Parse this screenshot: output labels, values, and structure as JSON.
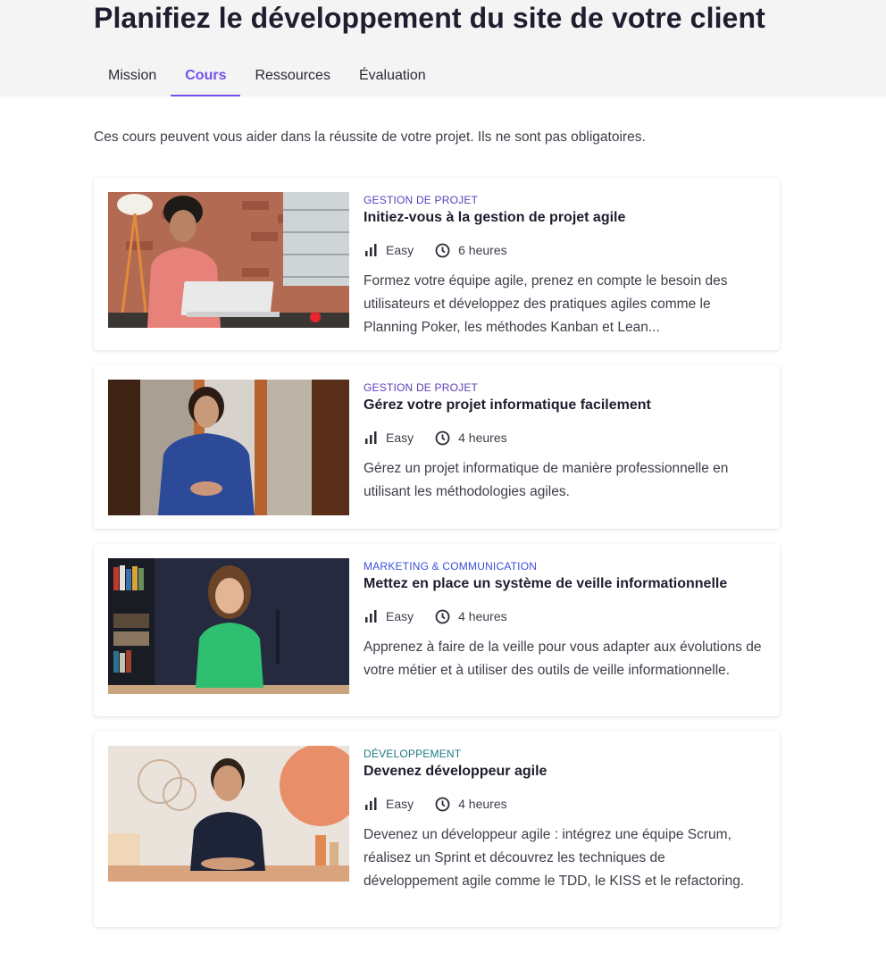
{
  "page": {
    "title": "Planifiez le développement du site de votre client",
    "tabs": [
      {
        "label": "Mission"
      },
      {
        "label": "Cours"
      },
      {
        "label": "Ressources"
      },
      {
        "label": "Évaluation"
      }
    ],
    "active_tab": "Cours",
    "intro": "Ces cours peuvent vous aider dans la réussite de votre projet. Ils ne sont pas obligatoires."
  },
  "colors": {
    "accent": "#7451eb",
    "category_project": "#5b3fb8",
    "category_marketing": "#3b4fd6",
    "category_dev": "#1e7a86"
  },
  "courses": [
    {
      "category": "Gestion de projet",
      "title": "Initiez-vous à la gestion de projet agile",
      "difficulty": "Easy",
      "duration": "6 heures",
      "description": "Formez votre équipe agile, prenez en compte le besoin des utilisateurs et développez des pratiques agiles comme le Planning Poker, les méthodes Kanban et Lean..."
    },
    {
      "category": "Gestion de projet",
      "title": "Gérez votre projet informatique facilement",
      "difficulty": "Easy",
      "duration": "4 heures",
      "description": "Gérez un projet informatique de manière professionnelle en utilisant les méthodologies agiles."
    },
    {
      "category": "Marketing & Communication",
      "title": "Mettez en place un système de veille informationnelle",
      "difficulty": "Easy",
      "duration": "4 heures",
      "description": "Apprenez à faire de la veille pour vous adapter aux évolutions de votre métier et à utiliser des outils de veille informationnelle."
    },
    {
      "category": "Développement",
      "title": "Devenez développeur agile",
      "difficulty": "Easy",
      "duration": "4 heures",
      "description": "Devenez un développeur agile : intégrez une équipe Scrum, réalisez un Sprint et découvrez les techniques de développement agile comme le TDD, le KISS et le refactoring."
    }
  ]
}
